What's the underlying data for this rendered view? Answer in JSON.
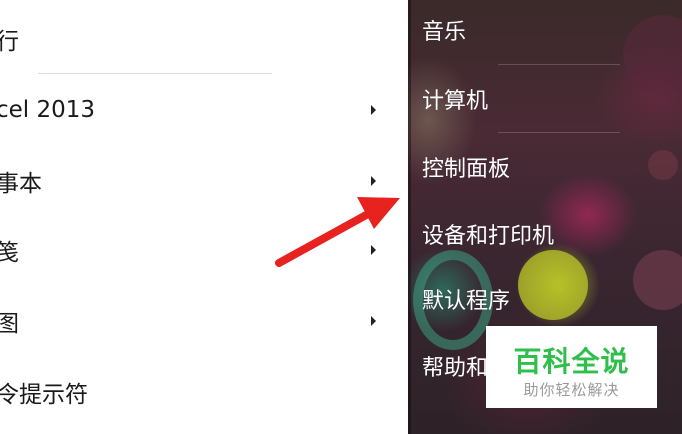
{
  "left_menu": {
    "items": [
      {
        "label": "行",
        "has_submenu": false
      },
      {
        "label": "cel 2013",
        "has_submenu": true
      },
      {
        "label": "事本",
        "has_submenu": true
      },
      {
        "label": "笺",
        "has_submenu": true
      },
      {
        "label": "图",
        "has_submenu": true
      },
      {
        "label": "令提示符",
        "has_submenu": false
      }
    ],
    "submenu_icon": "triangle-right-icon"
  },
  "right_menu": {
    "items": [
      {
        "label": "音乐"
      },
      {
        "label": "计算机"
      },
      {
        "label": "控制面板"
      },
      {
        "label": "设备和打印机"
      },
      {
        "label": "默认程序"
      },
      {
        "label": "帮助和"
      }
    ]
  },
  "annotation": {
    "icon": "red-arrow-icon",
    "color": "#e8231f"
  },
  "watermark": {
    "title": "百科全说",
    "subtitle": "助你轻松解决",
    "title_color": "#2fbf4a"
  }
}
